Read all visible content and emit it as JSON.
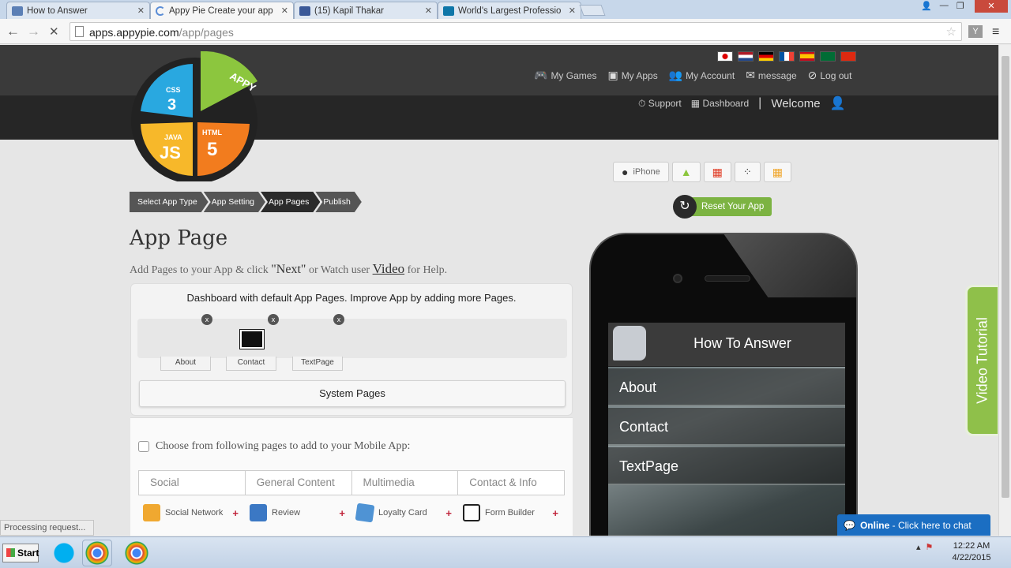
{
  "browser": {
    "tabs": [
      {
        "title": "How to Answer",
        "active": false
      },
      {
        "title": "Appy Pie Create your app",
        "active": true
      },
      {
        "title": "(15) Kapil Thakar",
        "active": false
      },
      {
        "title": "World's Largest Professio",
        "active": false
      }
    ],
    "url_domain": "apps.appypie.com",
    "url_path": "/app/pages",
    "status": "Processing request..."
  },
  "header": {
    "nav": [
      {
        "label": "My Games",
        "icon": "gamepad-icon"
      },
      {
        "label": "My Apps",
        "icon": "apps-icon"
      },
      {
        "label": "My Account",
        "icon": "users-icon"
      },
      {
        "label": "message",
        "icon": "mail-icon"
      },
      {
        "label": "Log out",
        "icon": "logout-icon"
      }
    ],
    "support": "Support",
    "dashboard": "Dashboard",
    "separator": "|",
    "welcome": "Welcome",
    "logo": {
      "appy": "APPY",
      "css": "CSS",
      "css_num": "3",
      "html": "HTML",
      "html_num": "5",
      "java": "JAVA",
      "js": "JS"
    }
  },
  "breadcrumbs": [
    "Select App Type",
    "App Setting",
    "App Pages",
    "Publish"
  ],
  "main": {
    "title": "App Page",
    "subtitle_pre": "Add Pages to your App & click ",
    "subtitle_next": "\"Next\"",
    "subtitle_mid": " or Watch user ",
    "subtitle_video": "Video",
    "subtitle_post": " for Help."
  },
  "dashboard": {
    "title": "Dashboard with default App Pages. Improve App by adding more Pages.",
    "pages": [
      "About",
      "Contact",
      "TextPage"
    ],
    "remove_label": "x",
    "system_pages": "System Pages"
  },
  "choose": {
    "label": "Choose from following pages to add to your Mobile App:",
    "categories": [
      "Social",
      "General Content",
      "Multimedia",
      "Contact & Info"
    ],
    "features": [
      "Social Network",
      "Review",
      "Loyalty Card",
      "Form Builder"
    ],
    "plus": "+"
  },
  "preview": {
    "devices": [
      "iPhone"
    ],
    "reset": "Reset Your App",
    "reset_icon": "↻",
    "app_title": "How To Answer",
    "menu": [
      "About",
      "Contact",
      "TextPage"
    ]
  },
  "side": {
    "video_tutorial": "Video Tutorial",
    "chat_status": "Online",
    "chat_text": " - Click here to chat"
  },
  "taskbar": {
    "start": "Start",
    "time": "12:22 AM",
    "date": "4/22/2015"
  },
  "colors": {
    "header_top": "#3a3a3a",
    "header_bottom": "#262626",
    "accent_green": "#7cb342",
    "chat_blue": "#1b6ec2"
  }
}
